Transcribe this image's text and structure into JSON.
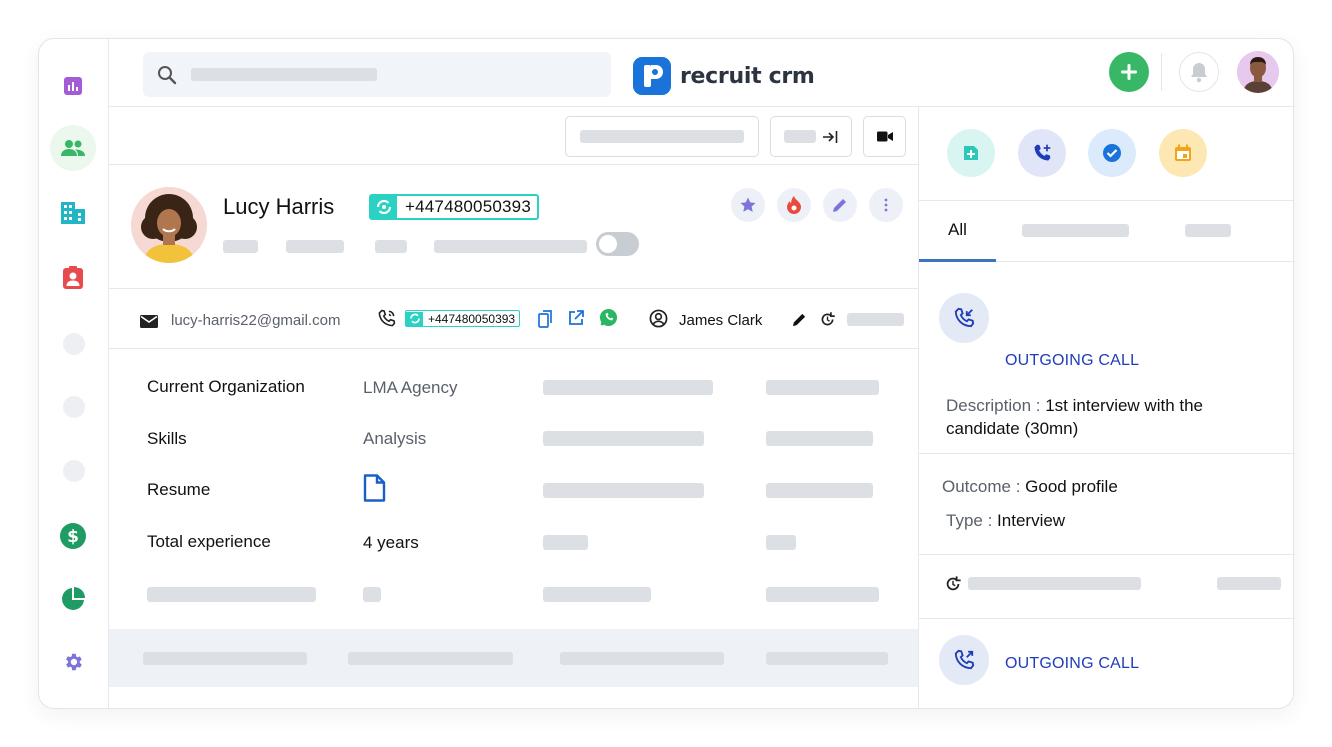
{
  "app": {
    "logo_text": "recruit crm"
  },
  "search": {
    "placeholder": ""
  },
  "sidebar": {
    "items": [
      {
        "name": "reports",
        "icon": "bar-chart-icon",
        "color": "#a45bd6"
      },
      {
        "name": "candidates",
        "icon": "people-icon",
        "color": "#38b866",
        "active": true
      },
      {
        "name": "companies",
        "icon": "building-icon",
        "color": "#22b5c6"
      },
      {
        "name": "contacts",
        "icon": "contact-card-icon",
        "color": "#e84b4b"
      },
      {
        "name": "billing",
        "icon": "dollar-icon",
        "color": "#1f9c63"
      },
      {
        "name": "analytics",
        "icon": "pie-chart-icon",
        "color": "#1f9c63"
      },
      {
        "name": "settings",
        "icon": "gear-icon",
        "color": "#7c74d9"
      }
    ]
  },
  "candidate": {
    "name": "Lucy Harris",
    "phone": "+447480050393",
    "email": "lucy-harris22@gmail.com",
    "owner": "James Clark"
  },
  "fields": [
    {
      "label": "Current Organization",
      "value": "LMA Agency"
    },
    {
      "label": "Skills",
      "value": "Analysis"
    },
    {
      "label": "Resume",
      "value": ""
    },
    {
      "label": "Total experience",
      "value": "4 years"
    }
  ],
  "panel": {
    "tab_all": "All",
    "activities": [
      {
        "type": "OUTGOING CALL",
        "description_label": "Description :",
        "description": "1st interview with the candidate (30mn)",
        "outcome_label": "Outcome :",
        "outcome": "Good profile",
        "type_label": "Type :",
        "type_value": "Interview"
      },
      {
        "type": "OUTGOING CALL"
      }
    ]
  },
  "colors": {
    "accent_blue": "#1a73d8",
    "teal_badge": "#2bd1c2",
    "green_add": "#38b866",
    "call_type": "#1f3db8"
  }
}
